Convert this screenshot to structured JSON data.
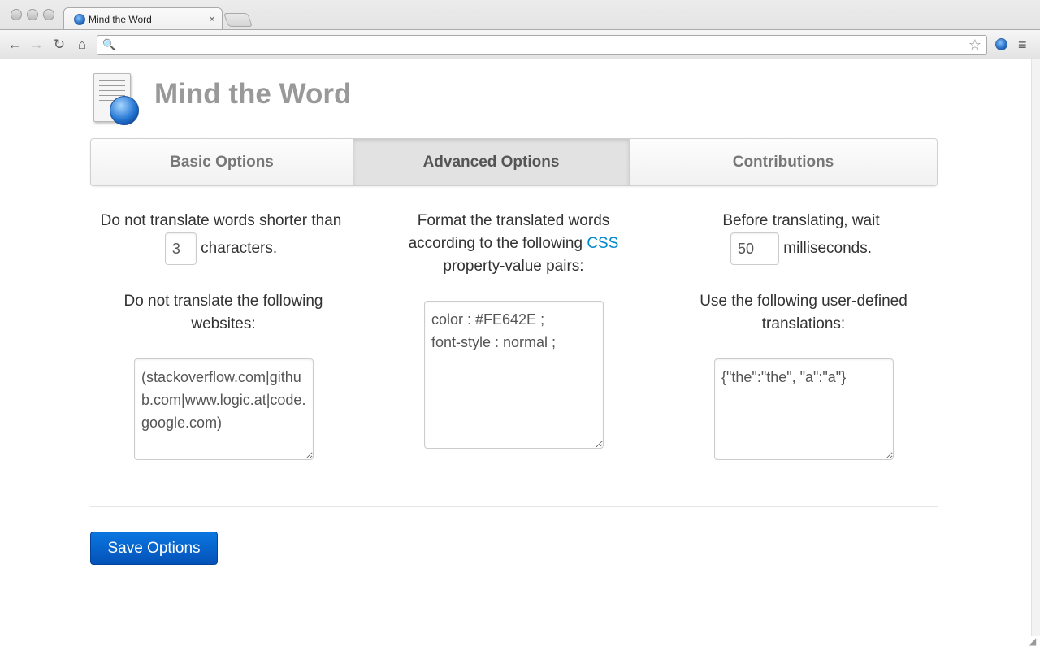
{
  "browser": {
    "tab_title": "Mind the Word",
    "tab_close": "×",
    "address": "",
    "back_glyph": "←",
    "forward_glyph": "→",
    "reload_glyph": "↻",
    "home_glyph": "⌂",
    "search_glyph": "🔍",
    "star_glyph": "☆",
    "menu_glyph": "≡"
  },
  "app": {
    "title": "Mind the Word",
    "logo_icon": "document-globe-icon"
  },
  "tabs": [
    {
      "label": "Basic Options",
      "active": false
    },
    {
      "label": "Advanced Options",
      "active": true
    },
    {
      "label": "Contributions",
      "active": false
    }
  ],
  "options": {
    "min_length": {
      "prefix": "Do not translate words shorter than",
      "value": "3",
      "suffix": "characters."
    },
    "blacklist": {
      "label": "Do not translate the following websites:",
      "value": "(stackoverflow.com|github.com|www.logic.at|code.google.com)"
    },
    "css": {
      "prefix": "Format the translated words according to the following",
      "link_text": "CSS",
      "suffix": "property-value pairs:",
      "value": "color : #FE642E ;\nfont-style : normal ;"
    },
    "delay": {
      "prefix": "Before translating, wait",
      "value": "50",
      "suffix": "milliseconds."
    },
    "user_translations": {
      "label": "Use the following user-defined translations:",
      "value": "{\"the\":\"the\", \"a\":\"a\"}"
    }
  },
  "save_button": {
    "label": "Save Options"
  },
  "colors": {
    "link": "#0088cc",
    "save_button": "#0452b8",
    "title": "#999999"
  }
}
